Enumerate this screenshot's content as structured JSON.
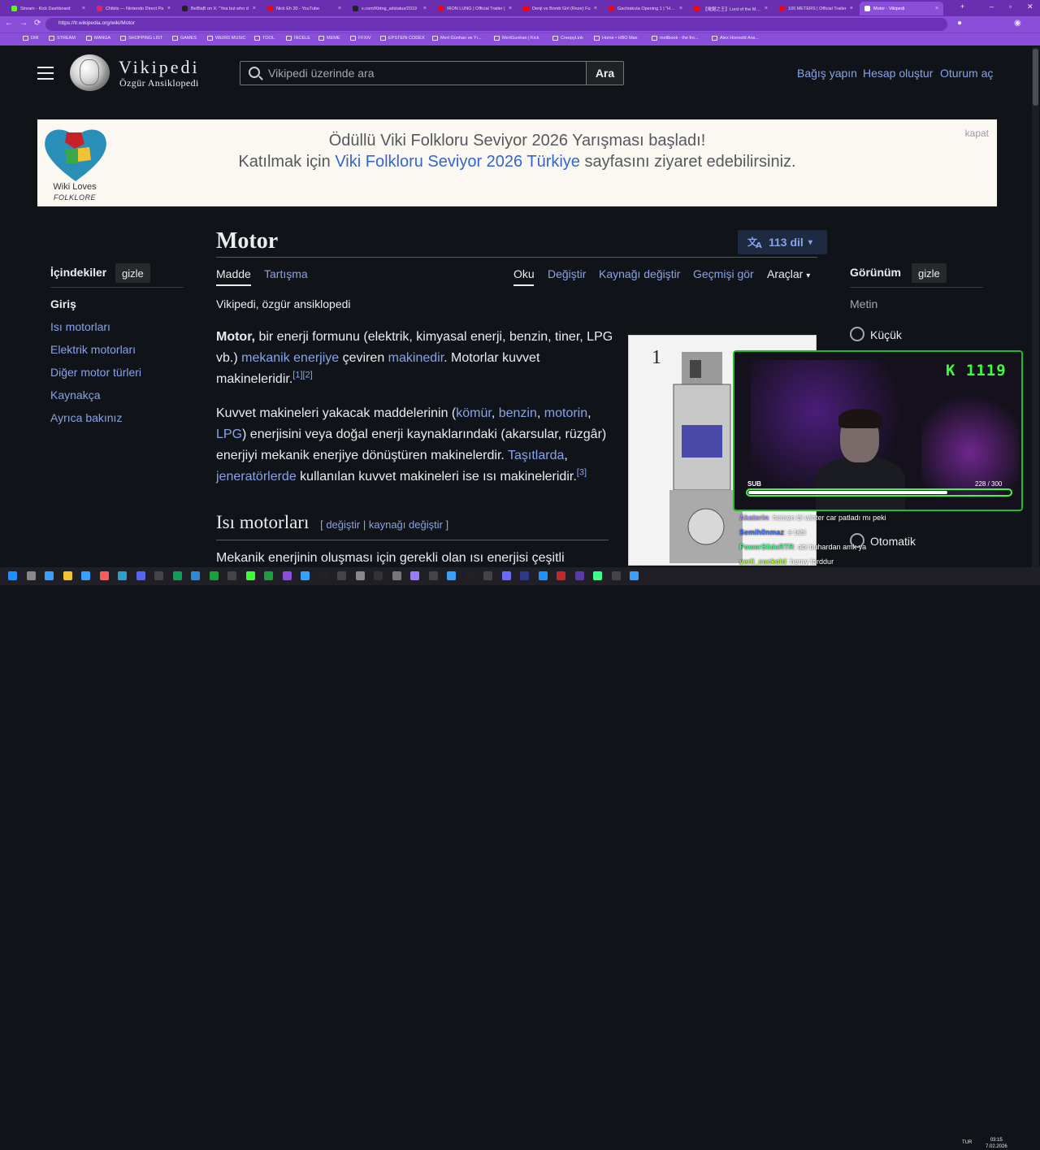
{
  "browser": {
    "tabs": [
      {
        "label": "Stream - Kick Dashboard",
        "color": "#53fc18"
      },
      {
        "label": "Chibiis — Nintendo Direct Pa",
        "color": "#e0245e"
      },
      {
        "label": "BeBlaB on X: \"Yea but who d",
        "color": "#222222"
      },
      {
        "label": "Nick Eh 30 - YouTube",
        "color": "#ff0000"
      },
      {
        "label": "x.com/Kbtng_ai/status/2019",
        "color": "#222222"
      },
      {
        "label": "IRON LUNG | Official Trailer |",
        "color": "#ff0000"
      },
      {
        "label": "Denji vs Bomb Girl (Reze) Fu",
        "color": "#ff0000"
      },
      {
        "label": "Gachiakuta Opening 1 | \"HUG",
        "color": "#ff0000"
      },
      {
        "label": "【電鋸之王】Lord of the Myst",
        "color": "#ff0000"
      },
      {
        "label": "100 METERS | Official Trailer",
        "color": "#ff0000"
      },
      {
        "label": "Motor - Vikipedi",
        "color": "#ffffff"
      }
    ],
    "url": "https://tr.wikipedia.org/wiki/Motor",
    "bookmarks": [
      "DIR",
      "STREAM",
      "MANGA",
      "SHOPPING LIST",
      "GAMES",
      "WEIRD MUSIC",
      "TOOL",
      "İNCELE",
      "MEME",
      "FFXIV",
      "EPSTEIN CODEX",
      "Mert Günhan ve Yı...",
      "MertGunhan | Kick",
      "CreepyLink",
      "Home • HBO Max",
      "moltbook - the fro...",
      "Alex Honnold Ans..."
    ]
  },
  "header": {
    "logo_word": "Vikipedi",
    "logo_tagline": "Özgür Ansiklopedi",
    "search_placeholder": "Vikipedi üzerinde ara",
    "search_button": "Ara",
    "links": [
      "Bağış yapın",
      "Hesap oluştur",
      "Oturum aç"
    ]
  },
  "banner": {
    "line1": "Ödüllü Viki Folkloru Seviyor 2026 Yarışması başladı!",
    "line2_pre": "Katılmak için ",
    "line2_link": "Viki Folkloru Seviyor 2026 Türkiye",
    "line2_post": " sayfasını ziyaret edebilirsiniz.",
    "close": "kapat",
    "logo_line1": "Wiki Loves",
    "logo_line2": "FOLKLORE"
  },
  "article": {
    "title": "Motor",
    "languages": "113 dil",
    "tabs_left": [
      "Madde",
      "Tartışma"
    ],
    "tabs_right": [
      "Oku",
      "Değiştir",
      "Kaynağı değiştir",
      "Geçmişi gör",
      "Araçlar"
    ],
    "tagline": "Vikipedi, özgür ansiklopedi",
    "p1": {
      "bold": "Motor,",
      "t1": " bir enerji formunu (elektrik, kimyasal enerji, benzin, tiner, LPG vb.) ",
      "a1": "mekanik enerjiye",
      "t2": " çeviren ",
      "a2": "makinedir",
      "t3": ". Motorlar kuvvet makineleridir.",
      "ref1": "[1]",
      "ref2": "[2]"
    },
    "p2": {
      "t1": "Kuvvet makineleri yakacak maddelerinin (",
      "a1": "kömür",
      "a2": "benzin",
      "a3": "motorin",
      "a4": "LPG",
      "t2": ") enerjisini veya doğal enerji kaynaklarındaki (akarsular, rüzgâr) enerjiyi mekanik enerjiye dönüştüren makinelerdir. ",
      "a5": "Taşıtlarda",
      "a6": "jeneratörlerde",
      "t3": " kullanılan kuvvet makineleri ise ısı makineleridir.",
      "ref3": "[3]",
      "sep": ", "
    },
    "h2": "Isı motorları",
    "h2_edit": "değiştir",
    "h2_edit_source": "kaynağı değiştir",
    "p3": "Mekanik enerjinin oluşması için gerekli olan ısı enerjisi çeşitli",
    "image_label": "1"
  },
  "toc": {
    "title": "İçindekiler",
    "hide": "gizle",
    "items": [
      "Giriş",
      "Isı motorları",
      "Elektrik motorları",
      "Diğer motor türleri",
      "Kaynakça",
      "Ayrıca bakınız"
    ]
  },
  "appearance": {
    "title": "Görünüm",
    "hide": "gizle",
    "text_label": "Metin",
    "option_small": "Küçük",
    "option_auto": "Otomatik"
  },
  "stream": {
    "kick_count": "K 1119",
    "sub_label": "SUB",
    "sub_current": "228",
    "sub_goal": "300",
    "sub_display": "228  / 300",
    "sub_progress": 0.76,
    "chat": [
      {
        "user": "Akaterin",
        "msg": ": hemen bi winter car patladı mı peki",
        "color": "#b08cff"
      },
      {
        "user": "Semih0nmaz",
        "msg": ": e tabi",
        "color": "#3a6bff"
      },
      {
        "user": "PowerSlideRTR",
        "msg": ": abi buhardan amk ya",
        "color": "#3aff8c"
      },
      {
        "user": "yerli_cuckold",
        "msg": ": henry forddur",
        "color": "#a6ff3a"
      }
    ]
  },
  "taskbar": {
    "lang": "TUR",
    "time": "03:15",
    "date": "7.02.2026"
  }
}
